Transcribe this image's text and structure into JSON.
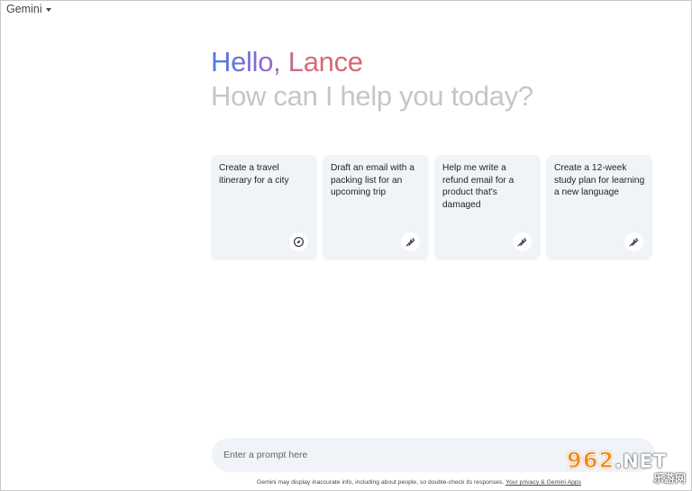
{
  "app": {
    "title": "Gemini"
  },
  "greeting": {
    "hello": "Hello, Lance",
    "subtitle": "How can I help you today?"
  },
  "cards": [
    {
      "text": "Create a travel itinerary for a city",
      "icon": "compass-icon"
    },
    {
      "text": "Draft an email with a packing list for an upcoming trip",
      "icon": "edit-sparkle-icon"
    },
    {
      "text": "Help me write a refund email for a product that's damaged",
      "icon": "edit-sparkle-icon"
    },
    {
      "text": "Create a 12-week study plan for learning a new language",
      "icon": "edit-sparkle-icon"
    }
  ],
  "prompt": {
    "placeholder": "Enter a prompt here"
  },
  "disclaimer": {
    "text": "Gemini may display inaccurate info, including about people, so double-check its responses. ",
    "link": "Your privacy & Gemini Apps"
  },
  "watermark": {
    "brand": "962",
    "tld": ".NET",
    "subtitle": "乐游网"
  },
  "colors": {
    "card_bg": "#f0f4f9",
    "subtitle": "#c4c7c5",
    "gradient_start": "#4b7be5",
    "gradient_end": "#d96570"
  }
}
